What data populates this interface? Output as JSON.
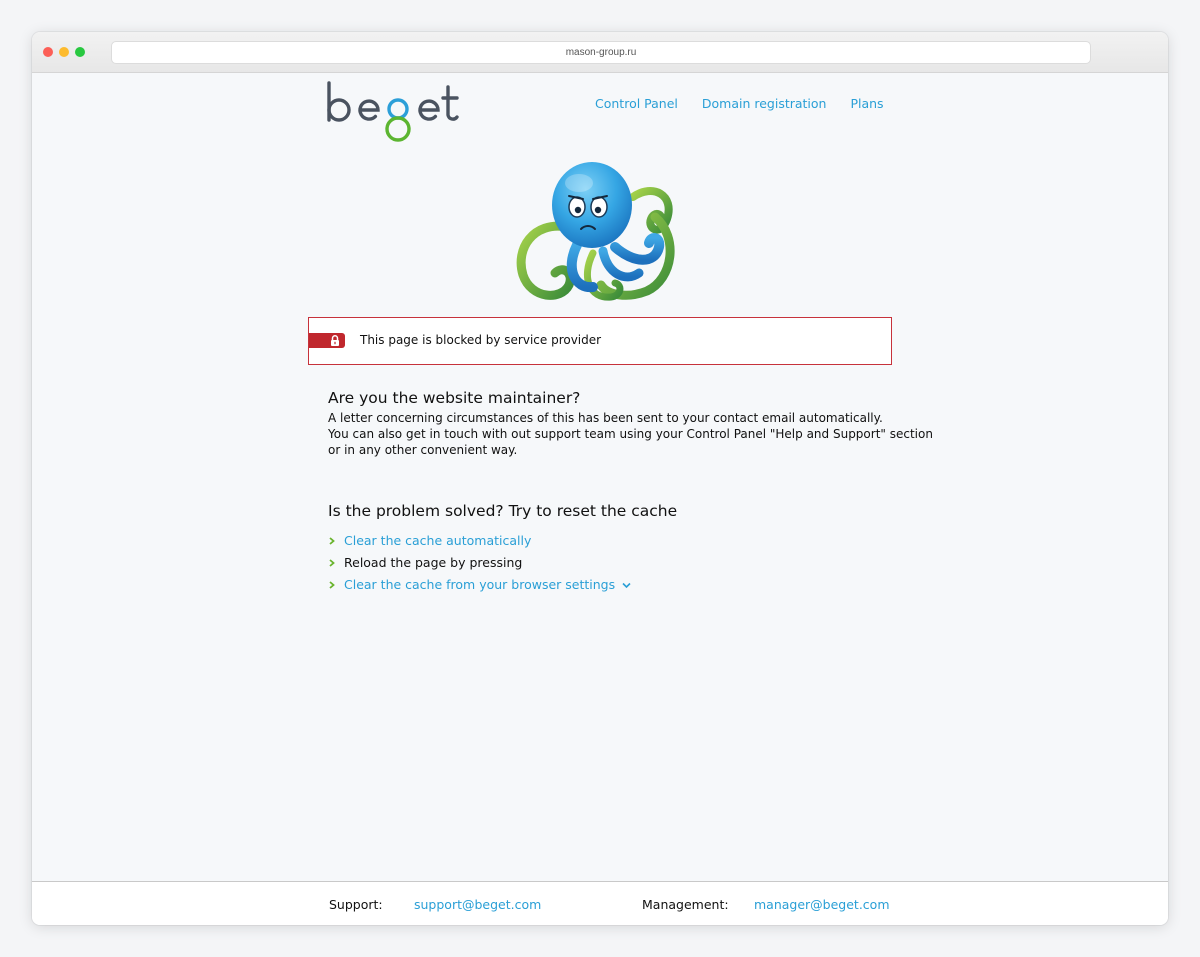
{
  "browser": {
    "url": "mason-group.ru"
  },
  "nav": {
    "items": [
      "Control Panel",
      "Domain registration",
      "Plans"
    ]
  },
  "alert": {
    "message": "This page is blocked by service provider"
  },
  "maintainer": {
    "heading": "Are you the website maintainer?",
    "lines": [
      "A letter concerning circumstances of this has been sent to your contact email automatically.",
      "You can also get in touch with out support team using your Control Panel \"Help and Support\" section",
      "or in any other convenient way."
    ]
  },
  "cache": {
    "heading": "Is the problem solved? Try to reset the cache",
    "items": [
      {
        "label": "Clear the cache automatically",
        "link": true
      },
      {
        "label": "Reload the page by pressing",
        "link": false
      },
      {
        "label": "Clear the cache from your browser settings",
        "link": true
      }
    ]
  },
  "footer": {
    "support_label": "Support:",
    "support_email": "support@beget.com",
    "management_label": "Management:",
    "management_email": "manager@beget.com"
  },
  "colors": {
    "accent": "#2a9fd6",
    "alert": "#c0272d",
    "chevron": "#6ab42d"
  }
}
